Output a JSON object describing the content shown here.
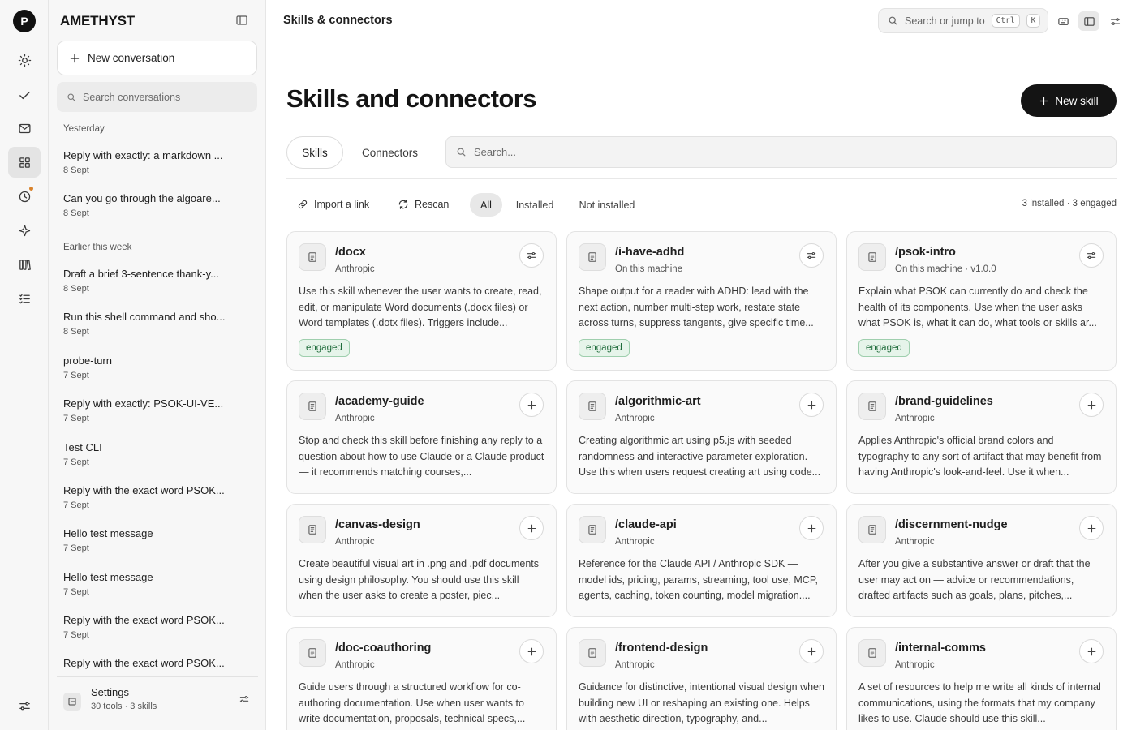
{
  "rail": {
    "logo": "P"
  },
  "sidebar": {
    "brand": "AMETHYST",
    "new_conversation": "New conversation",
    "search_placeholder": "Search conversations",
    "groups": [
      {
        "label": "Yesterday",
        "items": [
          {
            "title": "Reply with exactly: a markdown ...",
            "date": "8 Sept"
          },
          {
            "title": "Can you go through the algoare...",
            "date": "8 Sept"
          }
        ]
      },
      {
        "label": "Earlier this week",
        "items": [
          {
            "title": "Draft a brief 3-sentence thank-y...",
            "date": "8 Sept"
          },
          {
            "title": "Run this shell command and sho...",
            "date": "8 Sept"
          },
          {
            "title": "probe-turn",
            "date": "7 Sept"
          },
          {
            "title": "Reply with exactly: PSOK-UI-VE...",
            "date": "7 Sept"
          },
          {
            "title": "Test CLI",
            "date": "7 Sept"
          },
          {
            "title": "Reply with the exact word PSOK...",
            "date": "7 Sept"
          },
          {
            "title": "Hello test message",
            "date": "7 Sept"
          },
          {
            "title": "Hello test message",
            "date": "7 Sept"
          },
          {
            "title": "Reply with the exact word PSOK...",
            "date": "7 Sept"
          },
          {
            "title": "Reply with the exact word PSOK...",
            "date": ""
          }
        ]
      }
    ],
    "settings": {
      "title": "Settings",
      "subtitle": "30 tools · 3 skills"
    }
  },
  "topbar": {
    "title": "Skills & connectors",
    "jump_placeholder": "Search or jump to",
    "kbd1": "Ctrl",
    "kbd2": "K"
  },
  "page": {
    "heading": "Skills and connectors",
    "new_skill": "New skill",
    "tabs": [
      "Skills",
      "Connectors"
    ],
    "search_placeholder": "Search...",
    "actions": {
      "import": "Import a link",
      "rescan": "Rescan"
    },
    "filters": [
      "All",
      "Installed",
      "Not installed"
    ],
    "counts": "3 installed · 3 engaged"
  },
  "cards": [
    {
      "name": "/docx",
      "source": "Anthropic",
      "installed": true,
      "badge": "engaged",
      "desc": "Use this skill whenever the user wants to create, read, edit, or manipulate Word documents (.docx files) or Word templates (.dotx files). Triggers include..."
    },
    {
      "name": "/i-have-adhd",
      "source": "On this machine",
      "installed": true,
      "badge": "engaged",
      "desc": "Shape output for a reader with ADHD: lead with the next action, number multi-step work, restate state across turns, suppress tangents, give specific time..."
    },
    {
      "name": "/psok-intro",
      "source": "On this machine · v1.0.0",
      "installed": true,
      "badge": "engaged",
      "desc": "Explain what PSOK can currently do and check the health of its components. Use when the user asks what PSOK is, what it can do, what tools or skills ar..."
    },
    {
      "name": "/academy-guide",
      "source": "Anthropic",
      "installed": false,
      "badge": "",
      "desc": "Stop and check this skill before finishing any reply to a question about how to use Claude or a Claude product — it recommends matching courses,..."
    },
    {
      "name": "/algorithmic-art",
      "source": "Anthropic",
      "installed": false,
      "badge": "",
      "desc": "Creating algorithmic art using p5.js with seeded randomness and interactive parameter exploration. Use this when users request creating art using code..."
    },
    {
      "name": "/brand-guidelines",
      "source": "Anthropic",
      "installed": false,
      "badge": "",
      "desc": "Applies Anthropic's official brand colors and typography to any sort of artifact that may benefit from having Anthropic's look-and-feel. Use it when..."
    },
    {
      "name": "/canvas-design",
      "source": "Anthropic",
      "installed": false,
      "badge": "",
      "desc": "Create beautiful visual art in .png and .pdf documents using design philosophy. You should use this skill when the user asks to create a poster, piec..."
    },
    {
      "name": "/claude-api",
      "source": "Anthropic",
      "installed": false,
      "badge": "",
      "desc": "Reference for the Claude API / Anthropic SDK — model ids, pricing, params, streaming, tool use, MCP, agents, caching, token counting, model migration...."
    },
    {
      "name": "/discernment-nudge",
      "source": "Anthropic",
      "installed": false,
      "badge": "",
      "desc": "After you give a substantive answer or draft that the user may act on — advice or recommendations, drafted artifacts such as goals, plans, pitches,..."
    },
    {
      "name": "/doc-coauthoring",
      "source": "Anthropic",
      "installed": false,
      "badge": "",
      "desc": "Guide users through a structured workflow for co-authoring documentation. Use when user wants to write documentation, proposals, technical specs,..."
    },
    {
      "name": "/frontend-design",
      "source": "Anthropic",
      "installed": false,
      "badge": "",
      "desc": "Guidance for distinctive, intentional visual design when building new UI or reshaping an existing one. Helps with aesthetic direction, typography, and..."
    },
    {
      "name": "/internal-comms",
      "source": "Anthropic",
      "installed": false,
      "badge": "",
      "desc": "A set of resources to help me write all kinds of internal communications, using the formats that my company likes to use. Claude should use this skill..."
    }
  ],
  "icons": {
    "rail": [
      "sun-icon",
      "check-icon",
      "mail-icon",
      "grid-icon",
      "history-icon",
      "sparkle-icon",
      "library-icon",
      "checklist-icon",
      "sliders-icon"
    ],
    "card": "document-icon",
    "installed_button": "sliders-icon",
    "uninstalled_button": "plus-icon"
  },
  "colors": {
    "accent": "#141414",
    "engaged_bg": "#e6f4ea",
    "engaged_text": "#1e6b3a",
    "notification": "#d9822b"
  }
}
